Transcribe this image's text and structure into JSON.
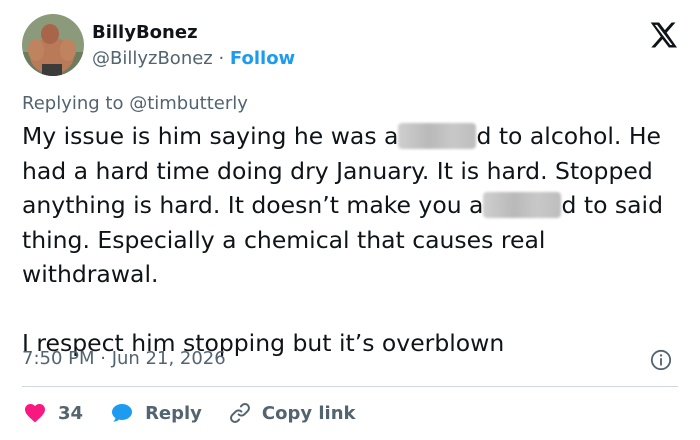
{
  "tweet": {
    "author_name": "BillyBonez",
    "author_handle": "@BillyzBonez",
    "separator": " · ",
    "follow_label": "Follow",
    "replying_prefix": "Replying to ",
    "replying_mention": "@timbutterly",
    "body": {
      "p1_a": "My issue is him saying he was a",
      "p1_b": "d to alcohol. He had a hard time doing dry January. It is hard. Stopped anything is hard. It doesn’t make you a",
      "p1_c": "d to said thing. Especially a chemical that causes real withdrawal.",
      "p2": "I respect him stopping but it’s overblown"
    },
    "timestamp": "7:50 PM · Jun 21, 2026",
    "likes": "34",
    "reply_label": "Reply",
    "copy_link_label": "Copy link"
  },
  "icons": {
    "platform": "x-logo-icon",
    "info": "info-icon",
    "like": "heart-icon",
    "reply": "speech-bubble-icon",
    "copy": "link-icon"
  },
  "colors": {
    "text": "#0f1419",
    "secondary": "#536471",
    "accent": "#1d9bf0",
    "like": "#f91880",
    "divider": "#cfd9de"
  }
}
